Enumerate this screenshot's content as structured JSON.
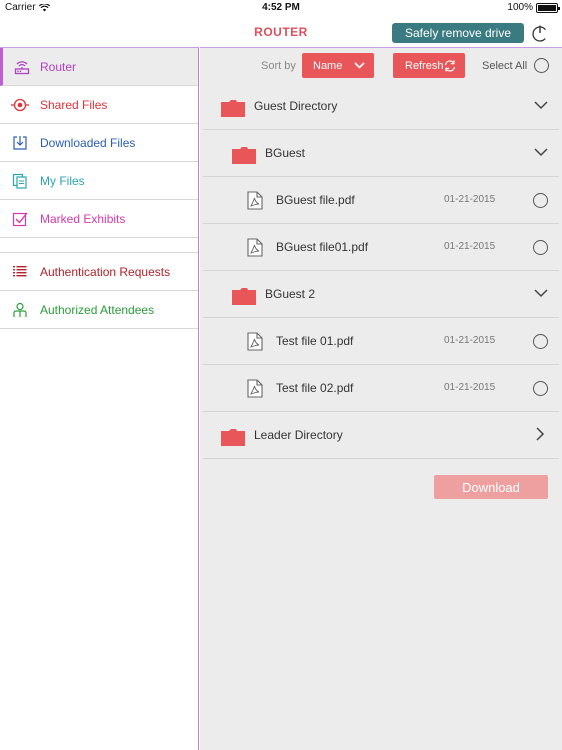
{
  "status_bar": {
    "carrier": "Carrier",
    "time": "4:52 PM",
    "battery": "100%",
    "battery_level": 1.0
  },
  "nav": {
    "title": "ROUTER",
    "safely_remove_label": "Safely remove drive",
    "power_icon": "power-icon"
  },
  "sidebar": {
    "items": [
      {
        "label": "Router",
        "icon": "router-icon",
        "color": "#b03fc4",
        "active": true
      },
      {
        "label": "Shared Files",
        "icon": "shared-target-icon",
        "color": "#e0323a"
      },
      {
        "label": "Downloaded Files",
        "icon": "download-icon",
        "color": "#2a5fb5"
      },
      {
        "label": "My Files",
        "icon": "my-files-icon",
        "color": "#2aa3b5"
      },
      {
        "label": "Marked Exhibits",
        "icon": "checkbox-icon",
        "color": "#d63aa8"
      },
      {
        "label": "Authentication Requests",
        "icon": "list-icon",
        "color": "#b0232a"
      },
      {
        "label": "Authorized Attendees",
        "icon": "attendee-icon",
        "color": "#2a9d3a"
      }
    ]
  },
  "toolbar": {
    "sort_by_label": "Sort by",
    "sort_value": "Name",
    "refresh_label": "Refresh",
    "select_all_label": "Select All"
  },
  "files": [
    {
      "type": "folder",
      "name": "Guest Directory",
      "expanded": true,
      "level": 0
    },
    {
      "type": "folder",
      "name": "BGuest",
      "expanded": true,
      "level": 1
    },
    {
      "type": "file",
      "name": "BGuest file.pdf",
      "date": "01-21-2015",
      "level": 2
    },
    {
      "type": "file",
      "name": "BGuest file01.pdf",
      "date": "01-21-2015",
      "level": 2
    },
    {
      "type": "folder",
      "name": "BGuest 2",
      "expanded": true,
      "level": 1
    },
    {
      "type": "file",
      "name": "Test file 01.pdf",
      "date": "01-21-2015",
      "level": 2
    },
    {
      "type": "file",
      "name": "Test file 02.pdf",
      "date": "01-21-2015",
      "level": 2
    },
    {
      "type": "folder",
      "name": "Leader Directory",
      "expanded": false,
      "level": 0
    }
  ],
  "download_label": "Download",
  "colors": {
    "accent_red": "#e95659",
    "teal_button": "#3a7b82",
    "folder_red": "#e95659",
    "download_disabled": "#eea0a1"
  }
}
